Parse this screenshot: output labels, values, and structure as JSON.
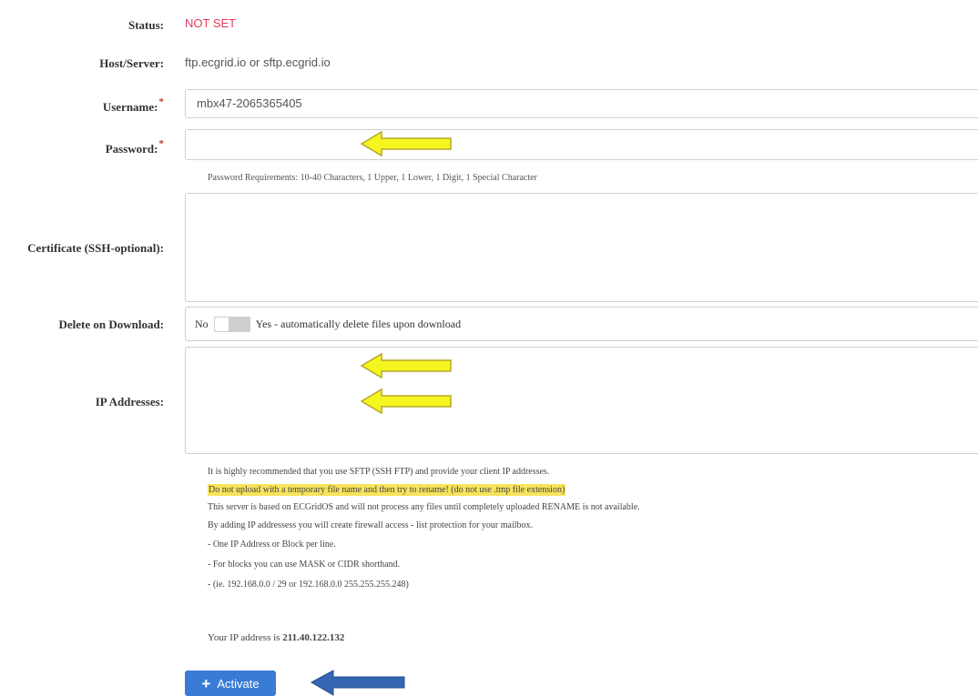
{
  "status": {
    "label": "Status:",
    "value": "NOT SET",
    "value_color": "#e03a5c"
  },
  "host": {
    "label": "Host/Server:",
    "value": "ftp.ecgrid.io or sftp.ecgrid.io"
  },
  "username": {
    "label": "Username:",
    "required_mark": "*",
    "value": "mbx47-2065365405"
  },
  "password": {
    "label": "Password:",
    "required_mark": "*",
    "value": "",
    "requirements": "Password Requirements: 10-40 Characters, 1 Upper, 1 Lower, 1 Digit, 1 Special Character"
  },
  "certificate": {
    "label": "Certificate (SSH-optional):",
    "value": ""
  },
  "delete_on_download": {
    "label": "Delete on Download:",
    "off_text": "No",
    "on_text": "Yes - automatically delete files upon download",
    "enabled": false
  },
  "ip_addresses": {
    "label": "IP Addresses:",
    "value": ""
  },
  "notes": {
    "line1": "It is highly recommended that you use SFTP (SSH FTP) and provide your client IP addresses.",
    "line2_highlight": "Do not upload with a temporary file name and then try to rename! (do not use .tmp file extension)",
    "line3": "This server is based on ECGridOS and will not process any files until completely uploaded RENAME is not available.",
    "line4": "By adding IP addressess you will create firewall access - list protection for your mailbox.",
    "line5": "- One IP Address or Block per line.",
    "line6": "- For blocks you can use MASK or CIDR shorthand.",
    "line7": "- (ie. 192.168.0.0 / 29 or 192.168.0.0 255.255.255.248)",
    "ip_prefix": "Your IP address is",
    "ip_value": "211.40.122.132"
  },
  "activate_button": {
    "icon": "plus-icon",
    "label": "Activate",
    "color": "#3a7bd5"
  },
  "annotations": {
    "yellow_arrow_color": "#f5f51f",
    "blue_arrow_color": "#3566b3"
  }
}
